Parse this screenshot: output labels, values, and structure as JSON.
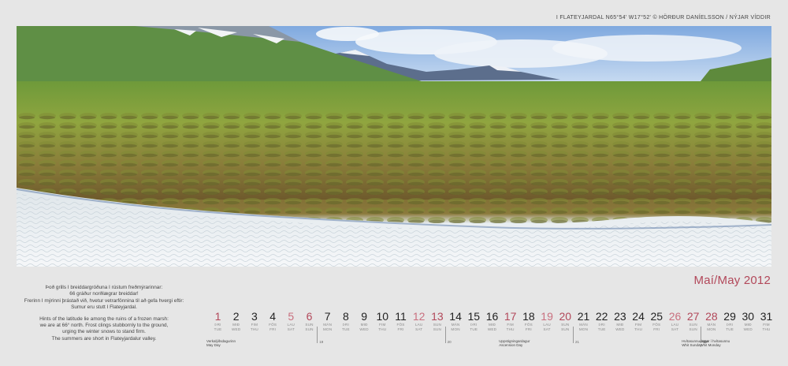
{
  "credit": "I FLATEYJARDAL N65°54' W17°52' © HÖRÐUR DANÍELSSON / NÝJAR VÍDDIR",
  "month_title": "Maí/May 2012",
  "caption": {
    "icelandic": [
      "Þoð grills I breiddargróðuna I rústum freðmýrarinnar:",
      "66 gráður norðlægrar breiddar!",
      "Frerinn I mýrinni þrástað við, hvetur vetrarfönnina til að gefa hvergi eftir:",
      "Sumur eru stutt I Flateyjardal."
    ],
    "english": [
      "Hints of the latitude lie among the ruins of a frozen marsh:",
      "we are at 66° north. Frost clings stubbornly to the ground,",
      "urging the winter snows to stand firm.",
      "The summers are short in Flateyjardalur valley."
    ]
  },
  "days": [
    {
      "num": "1",
      "wd": [
        "ÞRI",
        "TUE"
      ],
      "style": "red"
    },
    {
      "num": "2",
      "wd": [
        "MIÐ",
        "WED"
      ],
      "style": ""
    },
    {
      "num": "3",
      "wd": [
        "FIM",
        "THU"
      ],
      "style": ""
    },
    {
      "num": "4",
      "wd": [
        "FÖS",
        "FRI"
      ],
      "style": ""
    },
    {
      "num": "5",
      "wd": [
        "LAU",
        "SAT"
      ],
      "style": "sat"
    },
    {
      "num": "6",
      "wd": [
        "SUN",
        "SUN"
      ],
      "style": "sun"
    },
    {
      "num": "7",
      "wd": [
        "MÁN",
        "MON"
      ],
      "style": ""
    },
    {
      "num": "8",
      "wd": [
        "ÞRI",
        "TUE"
      ],
      "style": ""
    },
    {
      "num": "9",
      "wd": [
        "MIÐ",
        "WED"
      ],
      "style": ""
    },
    {
      "num": "10",
      "wd": [
        "FIM",
        "THU"
      ],
      "style": ""
    },
    {
      "num": "11",
      "wd": [
        "FÖS",
        "FRI"
      ],
      "style": ""
    },
    {
      "num": "12",
      "wd": [
        "LAU",
        "SAT"
      ],
      "style": "sat"
    },
    {
      "num": "13",
      "wd": [
        "SUN",
        "SUN"
      ],
      "style": "sun"
    },
    {
      "num": "14",
      "wd": [
        "MÁN",
        "MON"
      ],
      "style": ""
    },
    {
      "num": "15",
      "wd": [
        "ÞRI",
        "TUE"
      ],
      "style": ""
    },
    {
      "num": "16",
      "wd": [
        "MIÐ",
        "WED"
      ],
      "style": ""
    },
    {
      "num": "17",
      "wd": [
        "FIM",
        "THU"
      ],
      "style": "red"
    },
    {
      "num": "18",
      "wd": [
        "FÖS",
        "FRI"
      ],
      "style": ""
    },
    {
      "num": "19",
      "wd": [
        "LAU",
        "SAT"
      ],
      "style": "sat"
    },
    {
      "num": "20",
      "wd": [
        "SUN",
        "SUN"
      ],
      "style": "sun"
    },
    {
      "num": "21",
      "wd": [
        "MÁN",
        "MON"
      ],
      "style": ""
    },
    {
      "num": "22",
      "wd": [
        "ÞRI",
        "TUE"
      ],
      "style": ""
    },
    {
      "num": "23",
      "wd": [
        "MIÐ",
        "WED"
      ],
      "style": ""
    },
    {
      "num": "24",
      "wd": [
        "FIM",
        "THU"
      ],
      "style": ""
    },
    {
      "num": "25",
      "wd": [
        "FÖS",
        "FRI"
      ],
      "style": ""
    },
    {
      "num": "26",
      "wd": [
        "LAU",
        "SAT"
      ],
      "style": "sat"
    },
    {
      "num": "27",
      "wd": [
        "SUN",
        "SUN"
      ],
      "style": "sun"
    },
    {
      "num": "28",
      "wd": [
        "MÁN",
        "MON"
      ],
      "style": "red"
    },
    {
      "num": "29",
      "wd": [
        "ÞRI",
        "TUE"
      ],
      "style": ""
    },
    {
      "num": "30",
      "wd": [
        "MIÐ",
        "WED"
      ],
      "style": ""
    },
    {
      "num": "31",
      "wd": [
        "FIM",
        "THU"
      ],
      "style": ""
    }
  ],
  "holidays": [
    {
      "day": "1",
      "lines": [
        "Verkalýðsdagurinn",
        "May Day"
      ]
    },
    {
      "day": "17",
      "lines": [
        "Uppstigningardagur",
        "Ascension Day"
      ]
    },
    {
      "day": "27",
      "lines": [
        "Hvítasunnudagur",
        "Whit Sunday"
      ]
    },
    {
      "day": "28",
      "lines": [
        "Annar í hvítasunnu",
        "Whit Monday"
      ]
    }
  ],
  "weeks": [
    {
      "day": "7",
      "label": "19"
    },
    {
      "day": "14",
      "label": "20"
    },
    {
      "day": "21",
      "label": "21"
    },
    {
      "day": "28",
      "label": "22"
    }
  ],
  "colors": {
    "accent": "#b2485a",
    "background": "#e6e6e6"
  }
}
